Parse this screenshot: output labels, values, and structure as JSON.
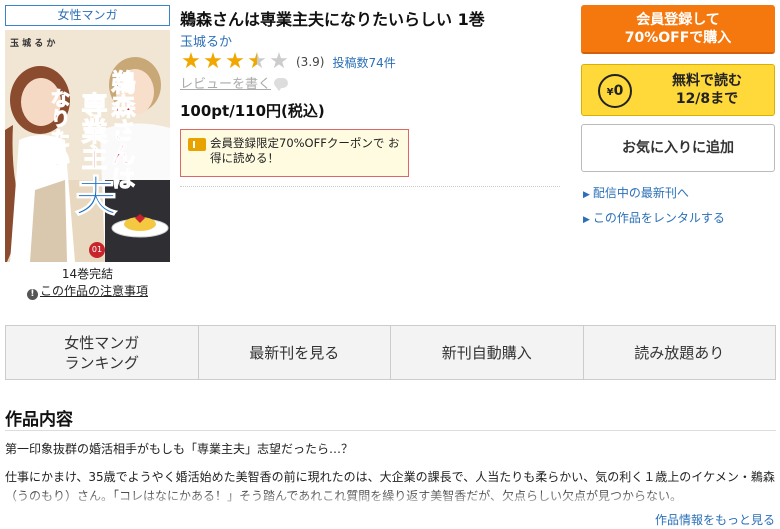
{
  "genre_tag": "女性マンガ",
  "cover": {
    "author_small": "玉 城 る か",
    "title_line1": "鵜森さんは",
    "title_line2": "専業主",
    "title_line3": "夫",
    "title_line4": "なりたい",
    "volume_badge": "01"
  },
  "volumes_status": "14巻完結",
  "notice_link": "この作品の注意事項",
  "title": "鵜森さんは専業主夫になりたいらしい 1巻",
  "author": "玉城るか",
  "rating": {
    "value": 3.9,
    "display": "(3.9)",
    "review_count": "投稿数74件",
    "max": 5
  },
  "write_review": "レビューを書く",
  "price": "100pt/110円(税込)",
  "coupon_text": "会員登録限定70%OFFクーポンで お得に読める！",
  "buttons": {
    "register_line1": "会員登録して",
    "register_line2": "70%OFFで購入",
    "free_line1": "無料で読む",
    "free_line2": "12/8まで",
    "free_icon_text": "0",
    "free_icon_yen": "¥",
    "favorite": "お気に入りに追加"
  },
  "side_links": [
    "配信中の最新刊へ",
    "この作品をレンタルする"
  ],
  "tabs": [
    {
      "line1": "女性マンガ",
      "line2": "ランキング"
    },
    {
      "line1": "最新刊を見る",
      "line2": ""
    },
    {
      "line1": "新刊自動購入",
      "line2": ""
    },
    {
      "line1": "読み放題あり",
      "line2": ""
    }
  ],
  "section_title": "作品内容",
  "description_lead": "第一印象抜群の婚活相手がもしも「専業主夫」志望だったら…？",
  "description_body": "仕事にかまけ、35歳でようやく婚活始めた美智香の前に現れたのは、大企業の課長で、人当たりも柔らかい、気の利く１歳上のイケメン・鵜森（うのもり）さん。「コレはなにかある！」そう踏んであれこれ質問を繰り返す美智香だが、欠点らしい欠点が見つからない。",
  "more_link": "作品情報をもっと見る",
  "colors": {
    "link": "#2a6fb8",
    "register_button": "#f5780f",
    "free_button": "#ffd83a",
    "star": "#f0a800"
  }
}
